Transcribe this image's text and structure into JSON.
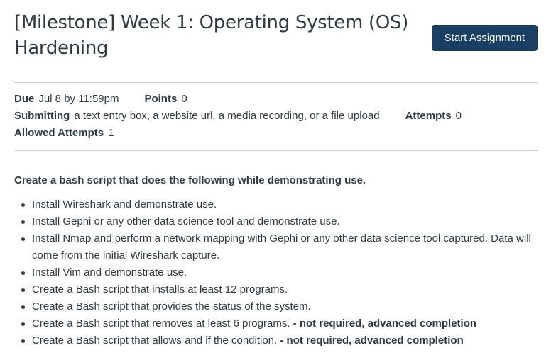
{
  "assignment": {
    "title": "[Milestone] Week 1: Operating System (OS) Hardening",
    "start_button": "Start Assignment"
  },
  "details": {
    "due_label": "Due",
    "due_value": "Jul 8 by 11:59pm",
    "points_label": "Points",
    "points_value": "0",
    "submitting_label": "Submitting",
    "submitting_value": "a text entry box, a website url, a media recording, or a file upload",
    "attempts_label": "Attempts",
    "attempts_value": "0",
    "allowed_attempts_label": "Allowed Attempts",
    "allowed_attempts_value": "1"
  },
  "description": {
    "intro": "Create a bash script that does the following while demonstrating use.",
    "tasks": [
      {
        "text": "Install Wireshark and demonstrate use.",
        "note": ""
      },
      {
        "text": "Install Gephi or any other data science tool and demonstrate use.",
        "note": ""
      },
      {
        "text": "Install Nmap and perform a network mapping with Gephi or any other data science tool captured. Data will come from the initial Wireshark capture.",
        "note": ""
      },
      {
        "text": "Install Vim and demonstrate use.",
        "note": ""
      },
      {
        "text": "Create a Bash script that installs at least 12 programs.",
        "note": ""
      },
      {
        "text": "Create a Bash script that provides the status of the system.",
        "note": ""
      },
      {
        "text": "Create a Bash script that removes at least 6 programs.",
        "note": "- not required, advanced completion"
      },
      {
        "text": "Create a Bash script that allows and if the condition.",
        "note": "- not required, advanced completion"
      }
    ]
  },
  "colors": {
    "button_bg": "#193f63",
    "text": "#2d3b45",
    "divider": "#c7cdd1"
  }
}
